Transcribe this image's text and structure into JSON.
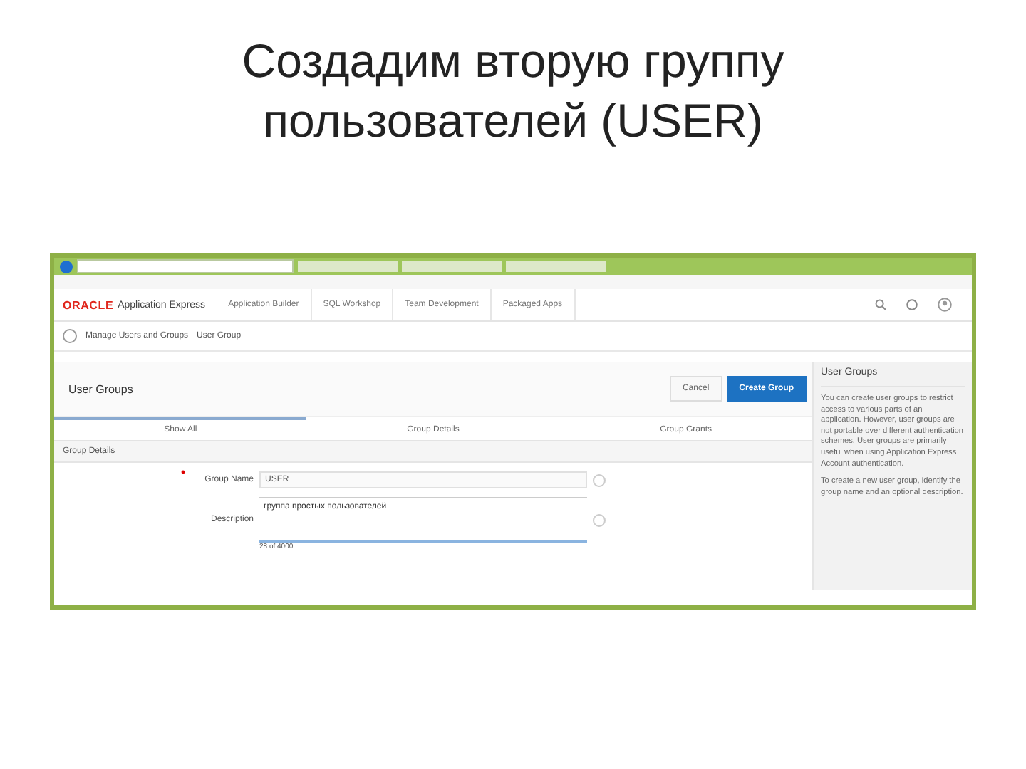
{
  "slide_title": "Создадим вторую группу пользователей (USER)",
  "app": {
    "logo": "ORACLE",
    "product": "Application Express",
    "nav": [
      {
        "label": "Application Builder"
      },
      {
        "label": "SQL Workshop"
      },
      {
        "label": "Team Development"
      },
      {
        "label": "Packaged Apps"
      }
    ],
    "breadcrumb": [
      {
        "label": "Manage Users and Groups"
      },
      {
        "label": "User Group"
      }
    ]
  },
  "region": {
    "title": "User Groups",
    "buttons": [
      {
        "label": "Cancel",
        "kind": "plain"
      },
      {
        "label": "Create Group",
        "kind": "hot"
      }
    ],
    "tabs": [
      {
        "label": "Show All",
        "selected": true
      },
      {
        "label": "Group Details",
        "selected": false
      },
      {
        "label": "Group Grants",
        "selected": false
      }
    ],
    "section": "Group Details",
    "fields": [
      {
        "label": "Group Name",
        "required": true,
        "value": "USER",
        "kind": "text"
      },
      {
        "label": "Description",
        "required": false,
        "value": "группа простых пользователей",
        "kind": "textarea",
        "counter": "28 of 4000"
      }
    ]
  },
  "help": {
    "title": "User Groups",
    "paragraphs": [
      "You can create user groups to restrict access to various parts of an application. However, user groups are not portable over different authentication schemes. User groups are primarily useful when using Application Express Account authentication.",
      "To create a new user group, identify the group name and an optional description."
    ]
  }
}
